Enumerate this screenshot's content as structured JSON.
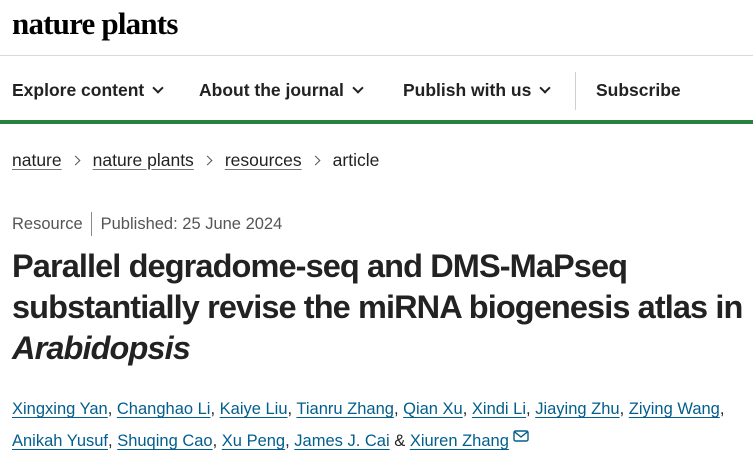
{
  "brand": {
    "logo_text": "nature plants"
  },
  "nav": {
    "items": [
      {
        "label": "Explore content"
      },
      {
        "label": "About the journal"
      },
      {
        "label": "Publish with us"
      }
    ],
    "subscribe": "Subscribe",
    "accent_color": "#29803f"
  },
  "breadcrumb": {
    "items": [
      "nature",
      "nature plants",
      "resources"
    ],
    "current": "article"
  },
  "article": {
    "type": "Resource",
    "published": "Published: 25 June 2024",
    "title_part1": "Parallel degradome-seq and DMS-MaPseq substantially revise the miRNA biogenesis atlas in ",
    "title_italic": "Arabidopsis",
    "authors": [
      "Xingxing Yan",
      "Changhao Li",
      "Kaiye Liu",
      "Tianru Zhang",
      "Qian Xu",
      "Xindi Li",
      "Jiaying Zhu",
      "Ziying Wang",
      "Anikah Yusuf",
      "Shuqing Cao",
      "Xu Peng",
      "James J. Cai",
      "Xiuren Zhang"
    ],
    "author_separator": ", ",
    "last_separator": " & ",
    "corresponding_icon": "mail-icon",
    "link_color": "#025e8d"
  }
}
